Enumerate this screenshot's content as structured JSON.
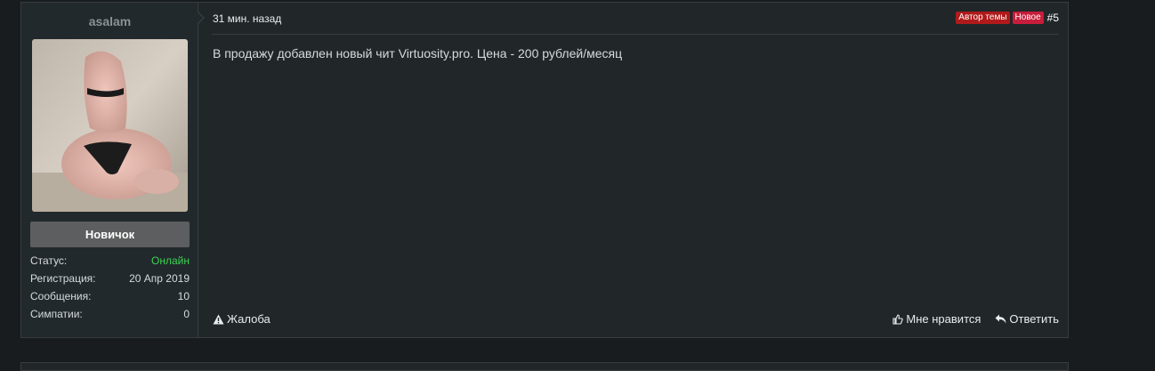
{
  "user": {
    "username": "asalam",
    "rank": "Новичок",
    "stats": [
      {
        "label": "Статус:",
        "value": "Онлайн"
      },
      {
        "label": "Регистрация:",
        "value": "20 Апр 2019"
      },
      {
        "label": "Сообщения:",
        "value": "10"
      },
      {
        "label": "Симпатии:",
        "value": "0"
      }
    ]
  },
  "post": {
    "time": "31 мин. назад",
    "badge_author": "Автор темы",
    "badge_new": "Новое",
    "number": "#5",
    "body": "В продажу добавлен новый чит Virtuosity.pro. Цена - 200 рублей/месяц",
    "report_label": "Жалоба",
    "like_label": "Мне нравится",
    "reply_label": "Ответить"
  },
  "colors": {
    "online": "#3cd454",
    "badge_author": "#b01a1a",
    "badge_new": "#c81d3a"
  },
  "icons": [
    "warning-icon",
    "thumbs-up-icon",
    "reply-icon"
  ]
}
